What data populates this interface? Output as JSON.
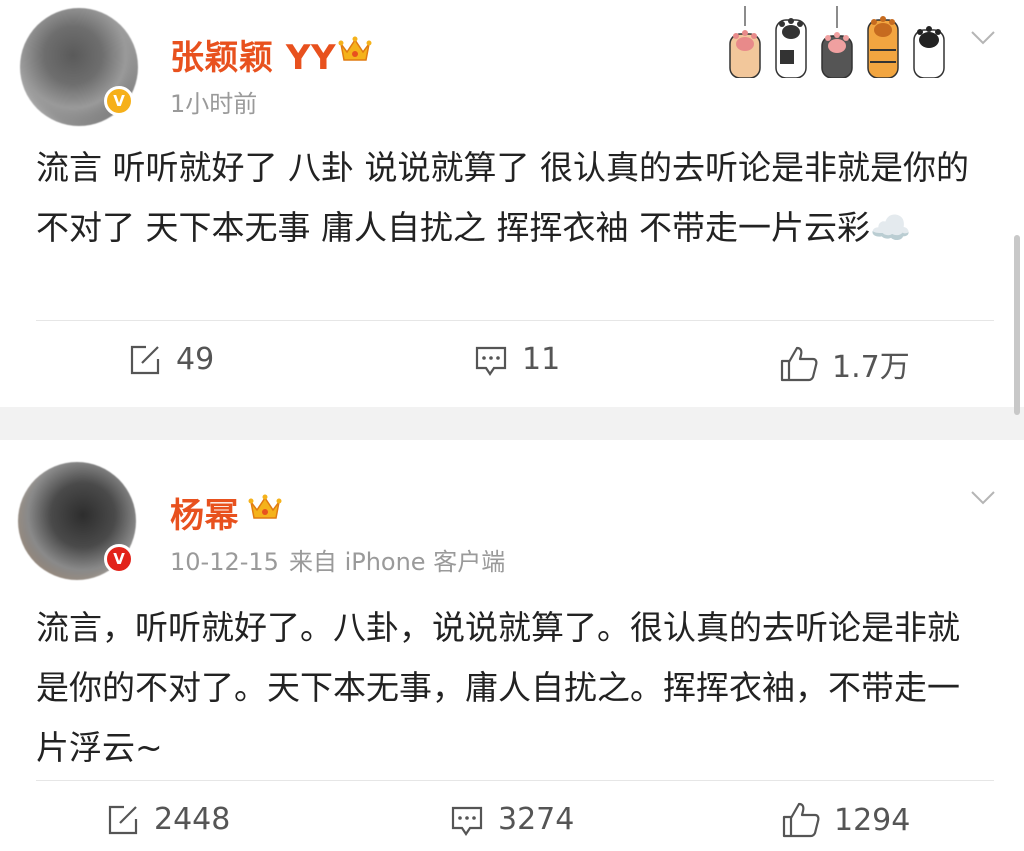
{
  "posts": [
    {
      "username": "张颖颖 YY",
      "time": "1小时前",
      "source": "",
      "text": "流言 听听就好了 八卦 说说就算了 很认真的去听论是非就是你的不对了 天下本无事 庸人自扰之 挥挥衣袖 不带走一片云彩",
      "emoji": "☁️",
      "verify_badge": "gold-v",
      "repost_count": "49",
      "comment_count": "11",
      "like_count": "1.7万"
    },
    {
      "username": "杨幂",
      "time": "10-12-15",
      "source": "来自 iPhone 客户端",
      "text": "流言，听听就好了。八卦，说说就算了。很认真的去听论是非就是你的不对了。天下本无事，庸人自扰之。挥挥衣袖，不带走一片浮云~",
      "verify_badge": "red-v",
      "repost_count": "2448",
      "comment_count": "3274",
      "like_count": "1294"
    }
  ],
  "colors": {
    "username": "#e8511e",
    "meta": "#9a9a9a",
    "text": "#222222",
    "action": "#555555",
    "badge_gold": "#f6b01a",
    "badge_red": "#e2231a"
  },
  "icons": [
    "crown-icon",
    "repost-icon",
    "comment-icon",
    "like-icon",
    "chevron-down-icon",
    "cat-paw-decoration",
    "verified-badge-icon"
  ]
}
